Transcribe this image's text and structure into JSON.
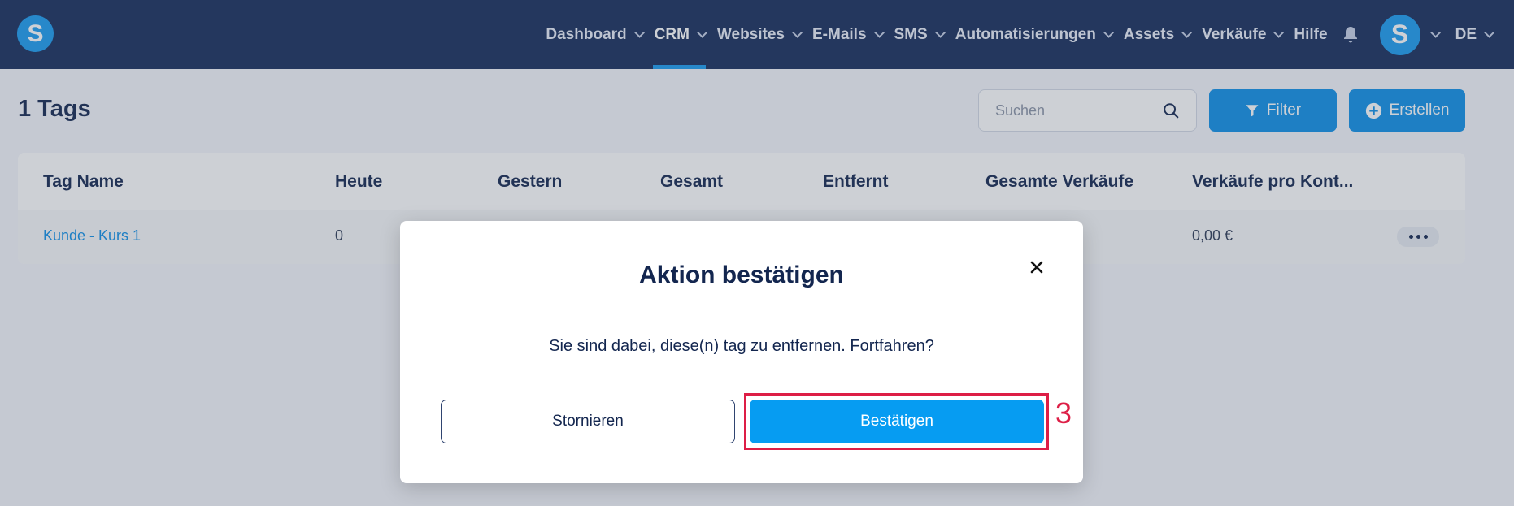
{
  "nav": {
    "logo_letter": "S",
    "items": [
      {
        "label": "Dashboard"
      },
      {
        "label": "CRM"
      },
      {
        "label": "Websites"
      },
      {
        "label": "E-Mails"
      },
      {
        "label": "SMS"
      },
      {
        "label": "Automatisierungen"
      },
      {
        "label": "Assets"
      },
      {
        "label": "Verkäufe"
      },
      {
        "label": "Hilfe"
      }
    ],
    "avatar_letter": "S",
    "language": "DE"
  },
  "page": {
    "title": "1 Tags",
    "search_placeholder": "Suchen",
    "filter_label": "Filter",
    "create_label": "Erstellen"
  },
  "table": {
    "columns": [
      "Tag Name",
      "Heute",
      "Gestern",
      "Gesamt",
      "Entfernt",
      "Gesamte Verkäufe",
      "Verkäufe pro Kont..."
    ],
    "rows": [
      {
        "tag_name": "Kunde - Kurs 1",
        "heute": "0",
        "verkaeufe_pro_kontakt": "0,00 €"
      }
    ]
  },
  "modal": {
    "title": "Aktion bestätigen",
    "message": "Sie sind dabei, diese(n) tag zu entfernen. Fortfahren?",
    "cancel_label": "Stornieren",
    "confirm_label": "Bestätigen"
  },
  "annotation": {
    "step_number": "3"
  },
  "colors": {
    "navbar_bg": "#152c5b",
    "accent": "#0d8fe8",
    "confirm_button": "#069cf2",
    "annotation": "#dd1e46",
    "text_dark": "#13264f"
  },
  "icons": [
    "logo-icon",
    "chevron-down-icon",
    "bell-icon",
    "search-icon",
    "filter-icon",
    "plus-circle-icon",
    "more-horizontal-icon",
    "close-icon"
  ]
}
